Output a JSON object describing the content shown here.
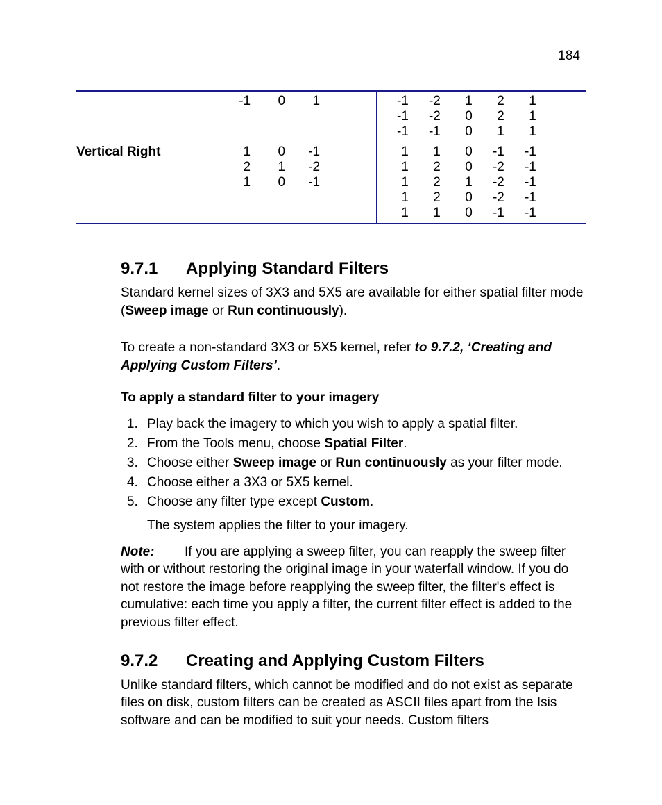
{
  "pagenum": "184",
  "table": {
    "row1": {
      "label": "",
      "m3": [
        [
          "-1",
          "0",
          "1"
        ]
      ],
      "m5": [
        [
          "-1",
          "-2",
          "1",
          "2",
          "1"
        ],
        [
          "-1",
          "-2",
          "0",
          "2",
          "1"
        ],
        [
          "-1",
          "-1",
          "0",
          "1",
          "1"
        ]
      ]
    },
    "row2": {
      "label": "Vertical Right",
      "m3": [
        [
          "1",
          "0",
          "-1"
        ],
        [
          "2",
          "1",
          "-2"
        ],
        [
          "1",
          "0",
          "-1"
        ]
      ],
      "m5": [
        [
          "1",
          "1",
          "0",
          "-1",
          "-1"
        ],
        [
          "1",
          "2",
          "0",
          "-2",
          "-1"
        ],
        [
          "1",
          "2",
          "1",
          "-2",
          "-1"
        ],
        [
          "1",
          "2",
          "0",
          "-2",
          "-1"
        ],
        [
          "1",
          "1",
          "0",
          "-1",
          "-1"
        ]
      ]
    }
  },
  "s971": {
    "num": "9.7.1",
    "title": "Applying Standard Filters",
    "p1a": "Standard kernel sizes of 3X3 and 5X5 are available for either spatial filter mode (",
    "p1b": "Sweep image",
    "p1c": " or ",
    "p1d": "Run continuously",
    "p1e": ").",
    "p2a": "To create a non-standard 3X3 or 5X5 kernel, refer ",
    "p2b": "to  9.7.2, ‘Creating and Applying Custom Filters’",
    "p2c": ".",
    "subtitle": "To apply a standard filter to your imagery",
    "steps": {
      "s1": "Play back the imagery to which you wish to apply a spatial filter.",
      "s2a": "From the Tools menu, choose ",
      "s2b": "Spatial Filter",
      "s2c": ".",
      "s3a": "Choose either ",
      "s3b": "Sweep image",
      "s3c": " or ",
      "s3d": "Run continuously",
      "s3e": " as your filter mode.",
      "s4": "Choose either a 3X3 or 5X5 kernel.",
      "s5a": "Choose any filter type except ",
      "s5b": "Custom",
      "s5c": "."
    },
    "step_result": "The system applies the filter to your imagery.",
    "note_label": "Note:",
    "note_text": "If you are applying a sweep filter, you can reapply the sweep filter with or without restoring the original image in your waterfall window. If you do not restore the image before reapplying the sweep filter, the filter's effect is cumulative: each time you apply a filter, the current filter effect is added to the previous filter effect."
  },
  "s972": {
    "num": "9.7.2",
    "title": "Creating and Applying Custom Filters",
    "p1": "Unlike standard filters, which cannot be modified and do not exist as separate files on disk, custom filters can be created as ASCII files apart from the Isis software and can be modified to suit your needs. Custom filters"
  }
}
